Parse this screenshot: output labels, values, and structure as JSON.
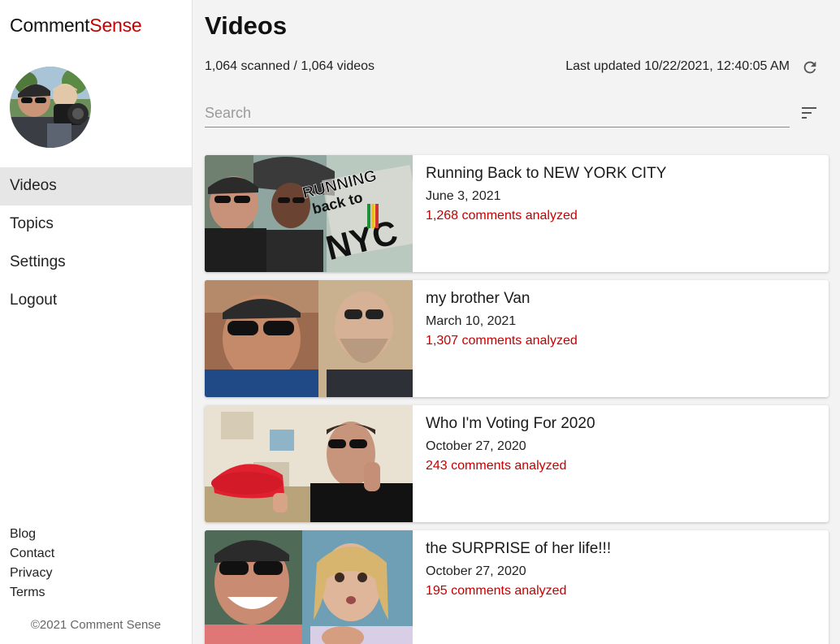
{
  "brand": {
    "part1": "Comment",
    "part2": "Sense",
    "accent_color": "#c40000"
  },
  "sidebar": {
    "nav": [
      {
        "label": "Videos",
        "active": true
      },
      {
        "label": "Topics",
        "active": false
      },
      {
        "label": "Settings",
        "active": false
      },
      {
        "label": "Logout",
        "active": false
      }
    ],
    "footer_links": [
      "Blog",
      "Contact",
      "Privacy",
      "Terms"
    ],
    "copyright": "©2021 Comment Sense"
  },
  "main": {
    "title": "Videos",
    "scan_status": "1,064 scanned / 1,064 videos",
    "last_updated": "Last updated 10/22/2021, 12:40:05 AM",
    "search": {
      "placeholder": "Search",
      "value": ""
    },
    "icons": {
      "refresh": "refresh-icon",
      "sort": "sort-icon"
    }
  },
  "videos": [
    {
      "title": "Running Back to NEW YORK CITY",
      "date": "June 3, 2021",
      "comments": "1,268 comments analyzed",
      "thumb_text": [
        "RUNNING",
        "back to",
        "NYC"
      ]
    },
    {
      "title": "my brother Van",
      "date": "March 10, 2021",
      "comments": "1,307 comments analyzed"
    },
    {
      "title": "Who I'm Voting For 2020",
      "date": "October 27, 2020",
      "comments": "243 comments analyzed"
    },
    {
      "title": "the SURPRISE of her life!!!",
      "date": "October 27, 2020",
      "comments": "195 comments analyzed"
    }
  ]
}
